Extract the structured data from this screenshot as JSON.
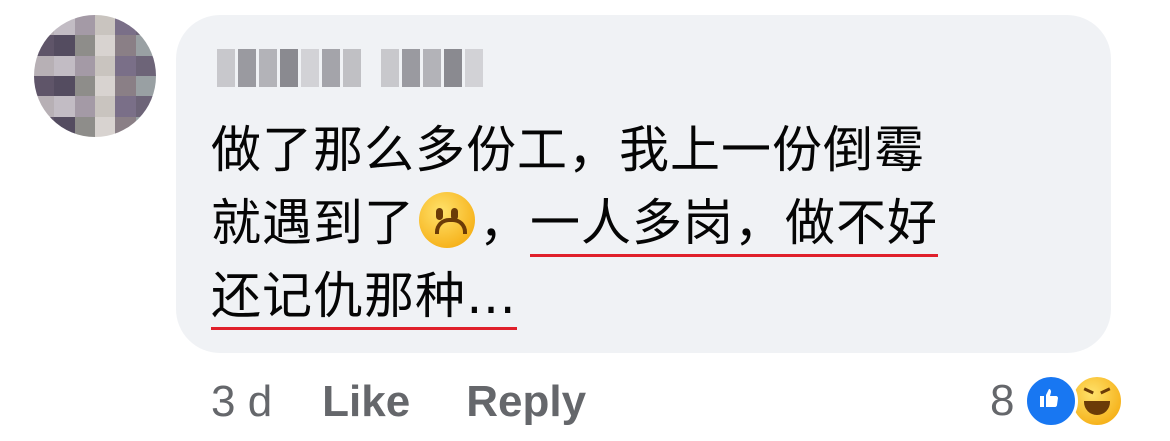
{
  "comment": {
    "lines": [
      {
        "plain": "做了那么多份工，我上一份倒霉"
      },
      {
        "before": "就遇到了",
        "emoji": "upside-down-face-emoji",
        "comma": "，",
        "underlined": "一人多岗，做不好"
      },
      {
        "underlined": "还记仇那种…"
      }
    ]
  },
  "meta": {
    "time": "3 d",
    "like": "Like",
    "reply": "Reply"
  },
  "reactions": {
    "count": "8",
    "icons": [
      "like-icon",
      "haha-icon"
    ]
  },
  "colors": {
    "bubble": "#f0f2f5",
    "text": "#050505",
    "meta": "#65676b",
    "underline": "#e0202b",
    "like_blue": "#1877f2"
  }
}
